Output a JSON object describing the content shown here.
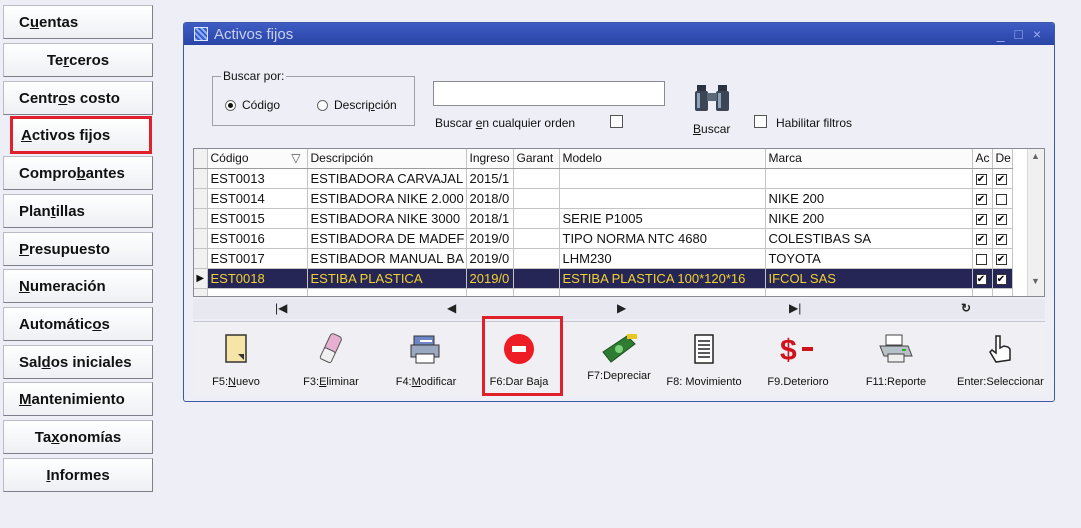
{
  "menu": {
    "items": [
      {
        "pre": "C",
        "u": "u",
        "post": "entas"
      },
      {
        "pre": "Te",
        "u": "r",
        "post": "ceros"
      },
      {
        "pre": "Centr",
        "u": "o",
        "post": "s costo"
      },
      {
        "pre": "",
        "u": "A",
        "post": "ctivos fijos"
      },
      {
        "pre": "Compro",
        "u": "b",
        "post": "antes"
      },
      {
        "pre": "Plan",
        "u": "t",
        "post": "illas"
      },
      {
        "pre": "",
        "u": "P",
        "post": "resupuesto"
      },
      {
        "pre": "",
        "u": "N",
        "post": "umeración"
      },
      {
        "pre": "Automátic",
        "u": "o",
        "post": "s"
      },
      {
        "pre": "Sal",
        "u": "d",
        "post": "os iniciales"
      },
      {
        "pre": "",
        "u": "M",
        "post": "antenimiento"
      },
      {
        "pre": "Ta",
        "u": "x",
        "post": "onomías"
      },
      {
        "pre": "",
        "u": "I",
        "post": "nformes"
      }
    ],
    "selected_index": 3
  },
  "window": {
    "title": "Activos fijos",
    "controls": "_ □ ×"
  },
  "search": {
    "group_label": "Buscar por:",
    "radio_code_pre": "Códi",
    "radio_code_u": "g",
    "radio_code_post": "o",
    "radio_desc_pre": "Descri",
    "radio_desc_u": "p",
    "radio_desc_post": "ción",
    "selected": "code",
    "input_value": "",
    "any_order_pre": "Buscar ",
    "any_order_u": "e",
    "any_order_post": "n cualquier orden",
    "any_order_checked": false,
    "search_button_u": "B",
    "search_button_post": "uscar",
    "filters_label": "Habilitar filtros",
    "filters_checked": false
  },
  "grid": {
    "columns": [
      "Código",
      "Descripción",
      "Ingreso",
      "Garant",
      "Modelo",
      "Marca",
      "Ac",
      "De"
    ],
    "sort_marker": "▽",
    "rows": [
      {
        "code": "EST0013",
        "desc": "ESTIBADORA CARVAJAL",
        "ingreso": "2015/1",
        "garant": "",
        "modelo": "",
        "marca": "",
        "ac": true,
        "de": true
      },
      {
        "code": "EST0014",
        "desc": "ESTIBADORA NIKE 2.000",
        "ingreso": "2018/0",
        "garant": "",
        "modelo": "",
        "marca": "NIKE 200",
        "ac": true,
        "de": false
      },
      {
        "code": "EST0015",
        "desc": "ESTIBADORA NIKE 3000",
        "ingreso": "2018/1",
        "garant": "",
        "modelo": "SERIE P1005",
        "marca": "NIKE 200",
        "ac": true,
        "de": true
      },
      {
        "code": "EST0016",
        "desc": "ESTIBADORA DE MADEF",
        "ingreso": "2019/0",
        "garant": "",
        "modelo": "TIPO NORMA NTC 4680",
        "marca": "COLESTIBAS SA",
        "ac": true,
        "de": true
      },
      {
        "code": "EST0017",
        "desc": "ESTIBADOR MANUAL BA",
        "ingreso": "2019/0",
        "garant": "",
        "modelo": "LHM230",
        "marca": "TOYOTA",
        "ac": false,
        "de": true
      },
      {
        "code": "EST0018",
        "desc": "ESTIBA PLASTICA",
        "ingreso": "2019/0",
        "garant": "",
        "modelo": "ESTIBA PLASTICA 100*120*16",
        "marca": "IFCOL SAS",
        "ac": true,
        "de": true
      }
    ],
    "selected_row": 5,
    "row_pointer": "▶"
  },
  "nav": {
    "first": "|◀",
    "prev": "◀",
    "next": "▶",
    "last": "▶|",
    "refresh": "↻"
  },
  "toolbar": {
    "buttons": [
      {
        "key": "F5:",
        "u": "N",
        "post": "uevo",
        "icon": "new-document-icon"
      },
      {
        "key": "F3:",
        "u": "E",
        "post": "liminar",
        "icon": "eraser-icon"
      },
      {
        "key": "F4:",
        "u": "M",
        "post": "odificar",
        "icon": "printer-edit-icon"
      },
      {
        "key": "F6:",
        "u": "",
        "post": "Dar Baja",
        "icon": "red-minus-icon"
      },
      {
        "key": "F7:",
        "u": "",
        "post": "Depreciar",
        "icon": "money-icon"
      },
      {
        "key": "F8: ",
        "u": "",
        "post": "Movimiento",
        "icon": "ledger-icon"
      },
      {
        "key": "F9.",
        "u": "",
        "post": "Deterioro",
        "icon": "dollar-minus-icon"
      },
      {
        "key": "F11:",
        "u": "",
        "post": "Reporte",
        "icon": "printer-icon"
      },
      {
        "key": "Enter:",
        "u": "",
        "post": "Seleccionar",
        "icon": "hand-pointer-icon"
      }
    ],
    "highlighted_index": 3
  },
  "colors": {
    "highlight": "#e0202a",
    "title_bar": "#2a44a6",
    "selected_row_bg": "#262656",
    "selected_row_fg": "#f2d230"
  }
}
